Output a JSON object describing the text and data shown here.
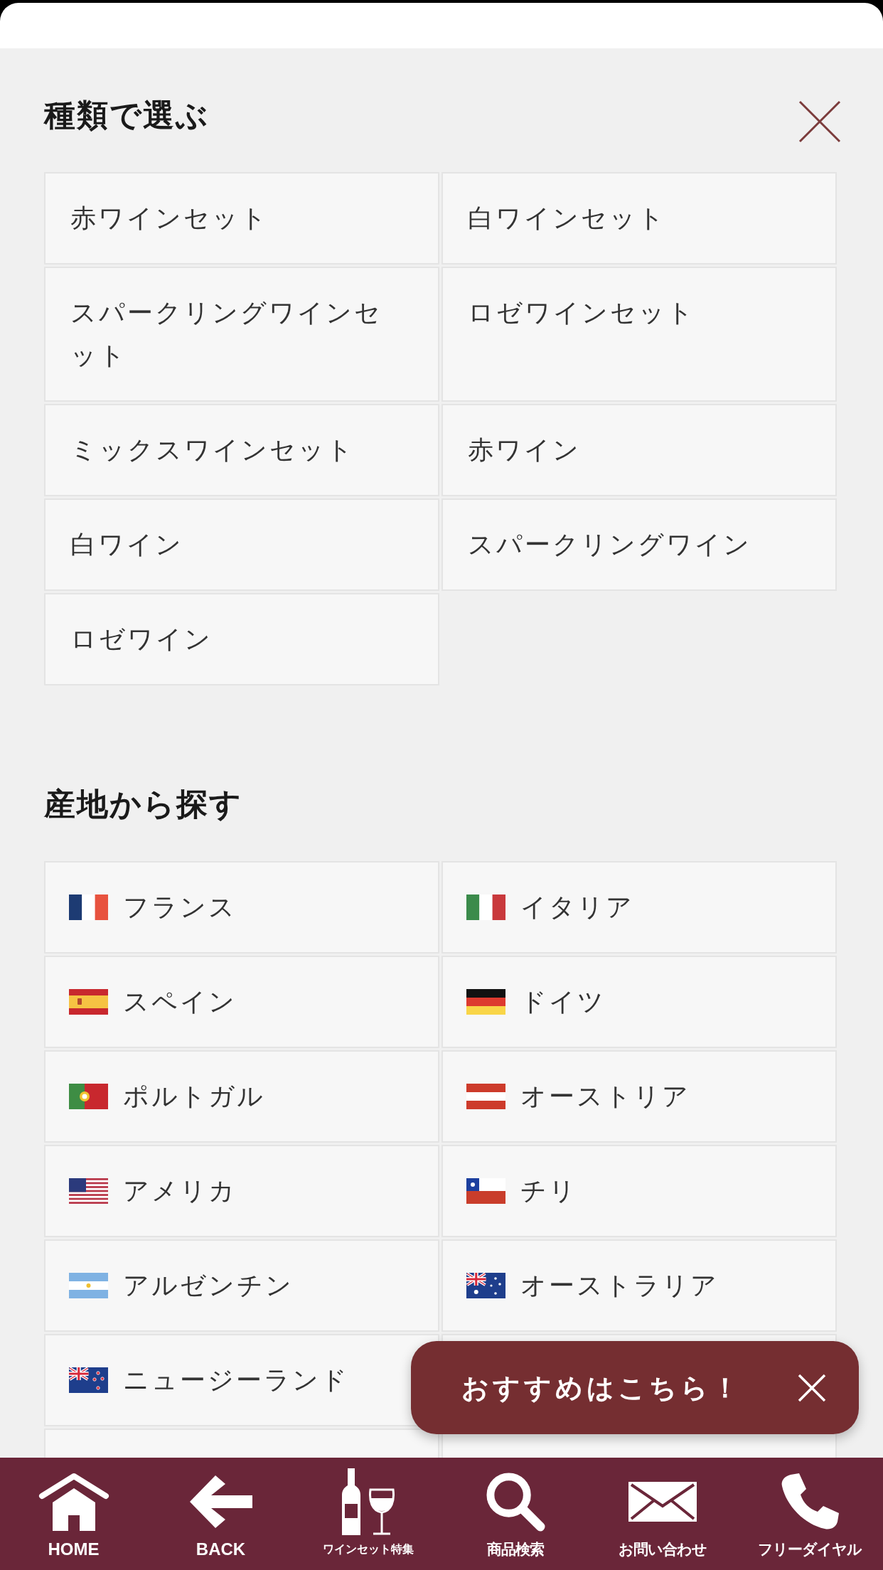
{
  "type_menu": {
    "title": "種類で選ぶ",
    "items": [
      "赤ワインセット",
      "白ワインセット",
      "スパークリングワインセット",
      "ロゼワインセット",
      "ミックスワインセット",
      "赤ワイン",
      "白ワイン",
      "スパークリングワイン",
      "ロゼワイン"
    ]
  },
  "origin_menu": {
    "title": "産地から探す",
    "items": [
      {
        "label": "フランス",
        "kind": "fr"
      },
      {
        "label": "イタリア",
        "kind": "it"
      },
      {
        "label": "スペイン",
        "kind": "es"
      },
      {
        "label": "ドイツ",
        "kind": "de"
      },
      {
        "label": "ポルトガル",
        "kind": "pt"
      },
      {
        "label": "オーストリア",
        "kind": "at"
      },
      {
        "label": "アメリカ",
        "kind": "us"
      },
      {
        "label": "チリ",
        "kind": "cl"
      },
      {
        "label": "アルゼンチン",
        "kind": "ar"
      },
      {
        "label": "オーストラリア",
        "kind": "au"
      },
      {
        "label": "ニュージーランド",
        "kind": "nz"
      }
    ]
  },
  "popup": {
    "text": "おすすめはこちら！"
  },
  "bottom_nav": [
    {
      "label": "HOME",
      "kind": "home"
    },
    {
      "label": "BACK",
      "kind": "back"
    },
    {
      "label": "ワインセット特集",
      "kind": "wine"
    },
    {
      "label": "商品検索",
      "kind": "search"
    },
    {
      "label": "お問い合わせ",
      "kind": "mail"
    },
    {
      "label": "フリーダイヤル",
      "kind": "phone"
    }
  ]
}
